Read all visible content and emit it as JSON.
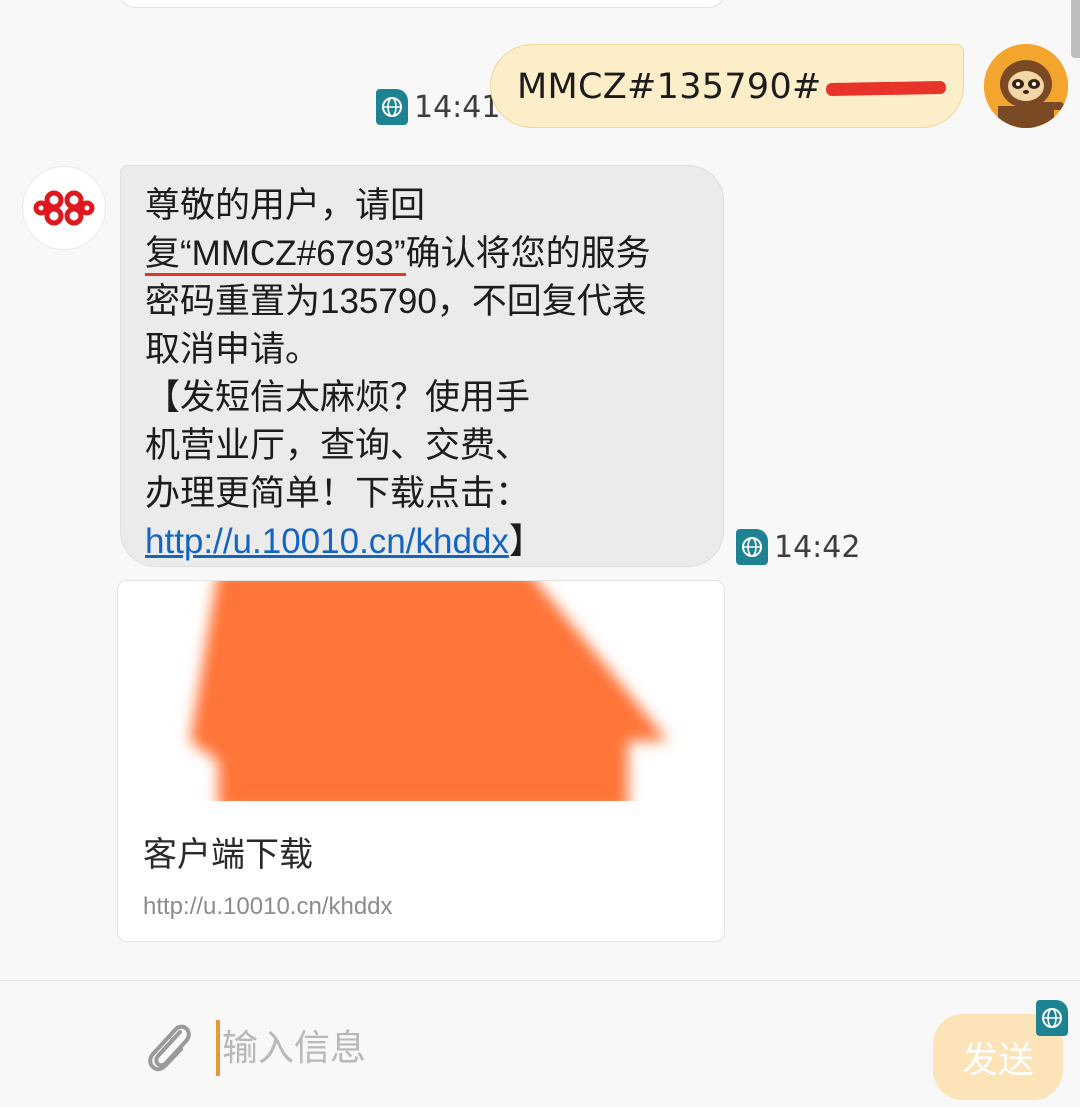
{
  "conversation": {
    "outgoing": {
      "text": "MMCZ#135790#",
      "time": "14:41"
    },
    "incoming": {
      "line1": "尊敬的用户，请回",
      "line2_prefix": "复",
      "line2_code": "“MMCZ#6793”",
      "line2_suffix": "确认将您的服务",
      "line3": "密码重置为135790，不回复代表",
      "line4": "取消申请。",
      "line5": "【发短信太麻烦？使用手",
      "line6": "机营业厅，查询、交费、",
      "line7": "办理更简单！下载点击：",
      "link": "http://u.10010.cn/khddx",
      "link_suffix": "】",
      "time": "14:42"
    },
    "preview": {
      "title": "客户端下载",
      "url": "http://u.10010.cn/khddx"
    }
  },
  "composer": {
    "placeholder": "输入信息",
    "send_label": "发送"
  },
  "colors": {
    "sim_badge": "#1d8392",
    "outgoing_bubble": "#fbeec8",
    "incoming_bubble": "#ebebeb",
    "link": "#1565c0",
    "redaction": "#e8332b",
    "preview_image": "#ff7539",
    "send_button": "#fce3b8"
  },
  "icons": {
    "sim": "globe-sim-icon",
    "attach": "paperclip-icon",
    "contact": "china-unicom-logo",
    "user": "sloth-avatar"
  }
}
